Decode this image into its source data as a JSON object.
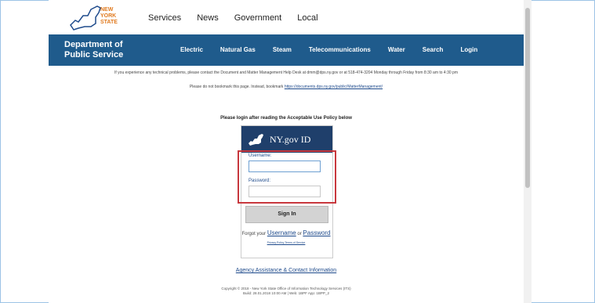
{
  "header": {
    "logo_text_1": "NEW",
    "logo_text_2": "YORK",
    "logo_text_3": "STATE",
    "nav": [
      "Services",
      "News",
      "Government",
      "Local"
    ]
  },
  "bluebar": {
    "dept_line1": "Department of",
    "dept_line2": "Public Service",
    "nav": [
      "Electric",
      "Natural Gas",
      "Steam",
      "Telecommunications",
      "Water",
      "Search",
      "Login"
    ],
    "color": "#1f5b8c"
  },
  "notices": {
    "line1": "If you experience any technical problems, please contact the Document and Matter Management Help Desk at dmm@dps.ny.gov or at 518-474-3204 Monday through Friday from 8:30 am to 4:30 pm",
    "line2_prefix": "Please do not bookmark this page. Instead, bookmark",
    "line2_link": "https://documents.dps.ny.gov/public/MatterManagement/"
  },
  "login": {
    "heading": "Please login after reading the Acceptable Use Policy below",
    "card_title": "NY.gov ID",
    "username_label": "Username:",
    "password_label": "Password:",
    "username_value": "",
    "password_value": "",
    "signin_label": "Sign In",
    "forgot_prefix": "Forgot your",
    "forgot_username": "Username",
    "forgot_or": "or",
    "forgot_password": "Password",
    "small_links": "Privacy Policy   Terms of Service"
  },
  "agency_link": "Agency Assistance & Contact Information",
  "footer": {
    "line1": "Copyright © 2018 - New York State Office of Information Technology Services (ITS)",
    "line2": "Build: 28.01.2018 10:00 AM | Web: 1BPF App: 1BPP_2"
  }
}
